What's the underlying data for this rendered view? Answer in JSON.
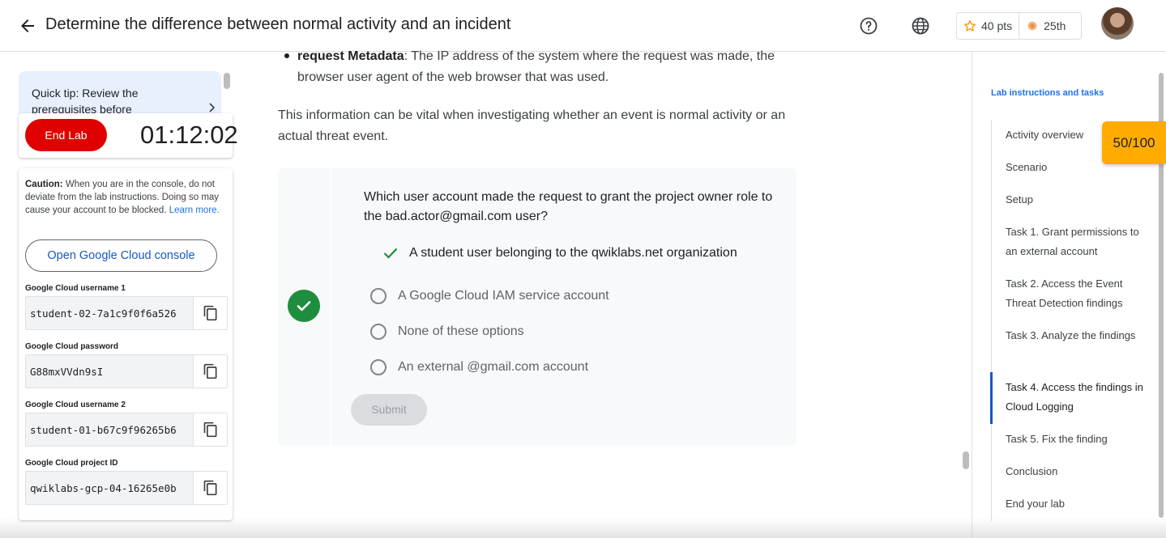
{
  "header": {
    "title": "Determine the difference between normal activity and an incident",
    "points": "40 pts",
    "rank": "25th"
  },
  "left_panel": {
    "tip": "Quick tip: Review the prerequisites before",
    "end_lab_label": "End Lab",
    "timer": "01:12:02",
    "caution_label": "Caution:",
    "caution_text": "When you are in the console, do not deviate from the lab instructions. Doing so may cause your account to be blocked.",
    "learn_more": "Learn more.",
    "console_button": "Open Google Cloud console",
    "credentials": [
      {
        "label": "Google Cloud username 1",
        "value": "student-02-7a1c9f0f6a526"
      },
      {
        "label": "Google Cloud password",
        "value": "G88mxVVdn9sI"
      },
      {
        "label": "Google Cloud username 2",
        "value": "student-01-b67c9f96265b6"
      },
      {
        "label": "Google Cloud project ID",
        "value": "qwiklabs-gcp-04-16265e0b"
      }
    ]
  },
  "content": {
    "bullet_bold": "request Metadata",
    "bullet_text": ": The IP address of the system where the request was made, the browser user agent of the web browser that was used.",
    "paragraph": "This information can be vital when investigating whether an event is normal activity or an actual threat event.",
    "quiz": {
      "question": "Which user account made the request to grant the project owner role to the bad.actor@gmail.com user?",
      "answer": "A student user belonging to the qwiklabs.net organization",
      "options": [
        "A Google Cloud IAM service account",
        "None of these options",
        "An external @gmail.com account"
      ],
      "submit": "Submit"
    }
  },
  "toc": {
    "heading": "Lab instructions and tasks",
    "items": [
      "Activity overview",
      "Scenario",
      "Setup",
      "Task 1. Grant permissions to an external account",
      "Task 2. Access the Event Threat Detection findings",
      "Task 3. Analyze the findings",
      "Task 4. Access the findings in Cloud Logging",
      "Task 5. Fix the finding",
      "Conclusion",
      "End your lab"
    ],
    "active_index": 6,
    "score": "50/100"
  },
  "colors": {
    "accent_blue": "#1a73e8",
    "end_lab_red": "#e00000",
    "success_green": "#1e8e3e",
    "score_amber": "#ffab00"
  }
}
